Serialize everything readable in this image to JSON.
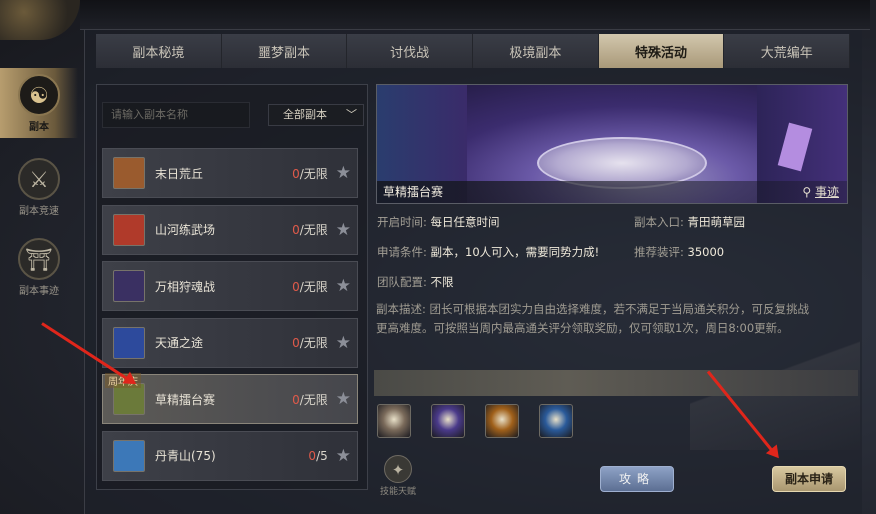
{
  "left_nav": [
    {
      "label": "副本",
      "icon": "dungeon-icon"
    },
    {
      "label": "副本竞速",
      "icon": "speedrun-icon"
    },
    {
      "label": "副本事迹",
      "icon": "records-icon"
    }
  ],
  "tabs": [
    "副本秘境",
    "噩梦副本",
    "讨伐战",
    "极境副本",
    "特殊活动",
    "大荒编年"
  ],
  "active_tab": "特殊活动",
  "search": {
    "placeholder": "请输入副本名称"
  },
  "filter": {
    "selected": "全部副本"
  },
  "list": [
    {
      "name": "末日荒丘",
      "done": "0",
      "limit": "/无限",
      "thumb_color": "#9a5b2e"
    },
    {
      "name": "山河练武场",
      "done": "0",
      "limit": "/无限",
      "thumb_color": "#b03a2a"
    },
    {
      "name": "万相狩魂战",
      "done": "0",
      "limit": "/无限",
      "thumb_color": "#3a3062"
    },
    {
      "name": "天通之途",
      "done": "0",
      "limit": "/无限",
      "thumb_color": "#2d4a9c"
    },
    {
      "name": "草精擂台赛",
      "done": "0",
      "limit": "/无限",
      "thumb_color": "#6b7a3a",
      "badge": "周年庆"
    },
    {
      "name": "丹青山(75)",
      "done": "0",
      "limit": "/5",
      "thumb_color": "#3c78b8"
    }
  ],
  "detail": {
    "banner_title": "草精擂台赛",
    "banner_link": "事迹",
    "open_time_label": "开启时间:",
    "open_time": "每日任意时间",
    "entrance_label": "副本入口:",
    "entrance": "青田萌草园",
    "condition_label": "申请条件:",
    "condition": "副本，10人可入，需要同势力成!",
    "gear_label": "推荐装评:",
    "gear": "35000",
    "team_label": "团队配置:",
    "team": "不限",
    "desc_label": "副本描述:",
    "desc": "团长可根据本团实力自由选择难度，若不满足于当局通关积分，可反复挑战更高难度。可按照当周内最高通关评分领取奖励，仅可领取1次，周日8:00更新。"
  },
  "rewards": [
    {
      "icon": "portrait-reward-icon",
      "color": "#7a6a5a"
    },
    {
      "icon": "magic-hands-reward-icon",
      "color": "#4a3a8a"
    },
    {
      "icon": "fire-orb-reward-icon",
      "color": "#a0601a"
    },
    {
      "icon": "sword-orb-reward-icon",
      "color": "#2a5a9a"
    }
  ],
  "talent_label": "技能天赋",
  "buttons": {
    "guide": "攻略",
    "apply": "副本申请"
  },
  "colors": {
    "accent_gold": "#b79d6e",
    "arrow_red": "#e0261b",
    "count_red": "#e05a4a"
  }
}
